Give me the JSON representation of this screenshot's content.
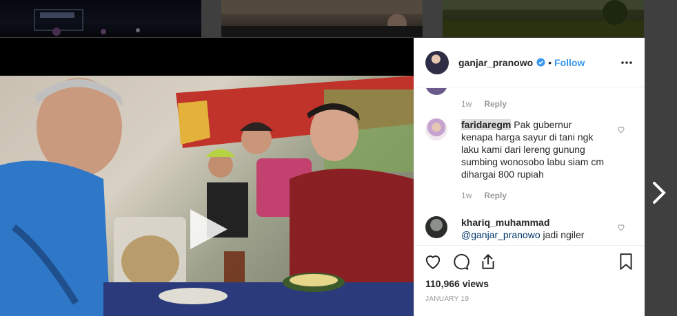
{
  "post": {
    "username": "ganjar_pranowo",
    "separator": "•",
    "follow_label": "Follow",
    "views": "110,966 views",
    "date": "JANUARY 19"
  },
  "comments": [
    {
      "time": "1w",
      "reply_label": "Reply"
    },
    {
      "user": "faridaregm",
      "text": "Pak gubernur kenapa harga sayur di tani ngk laku kami dari lereng gunung sumbing wonosobo labu siam cm dihargai 800 rupiah",
      "time": "1w",
      "reply_label": "Reply"
    },
    {
      "user": "khariq_muhammad",
      "mention": "@ganjar_pranowo",
      "text": "jadi ngiler"
    }
  ],
  "colors": {
    "accent": "#3897f0",
    "text": "#262626",
    "muted": "#999999"
  },
  "icons": [
    "verified-badge-icon",
    "more-options-icon",
    "heart-icon",
    "comment-icon",
    "share-icon",
    "bookmark-icon",
    "play-icon",
    "chevron-right-icon"
  ]
}
